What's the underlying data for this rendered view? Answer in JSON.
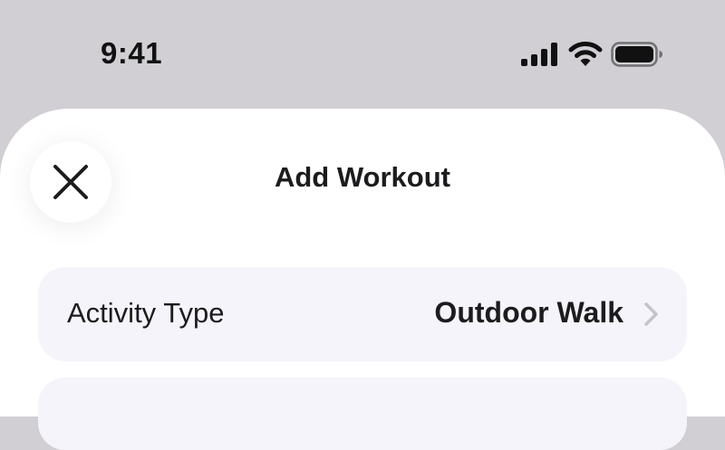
{
  "status_bar": {
    "time": "9:41",
    "icons": [
      "cellular-signal-icon",
      "wifi-icon",
      "battery-icon"
    ]
  },
  "sheet": {
    "title": "Add Workout",
    "close_icon": "close-icon",
    "rows": [
      {
        "label": "Activity Type",
        "value": "Outdoor Walk",
        "icon": "chevron-right-icon"
      }
    ]
  },
  "colors": {
    "backdrop": "#d1cfd4",
    "sheet": "#ffffff",
    "row_background": "#f4f4fa",
    "text": "#1c1c1e",
    "chevron": "#c4c4c8"
  }
}
